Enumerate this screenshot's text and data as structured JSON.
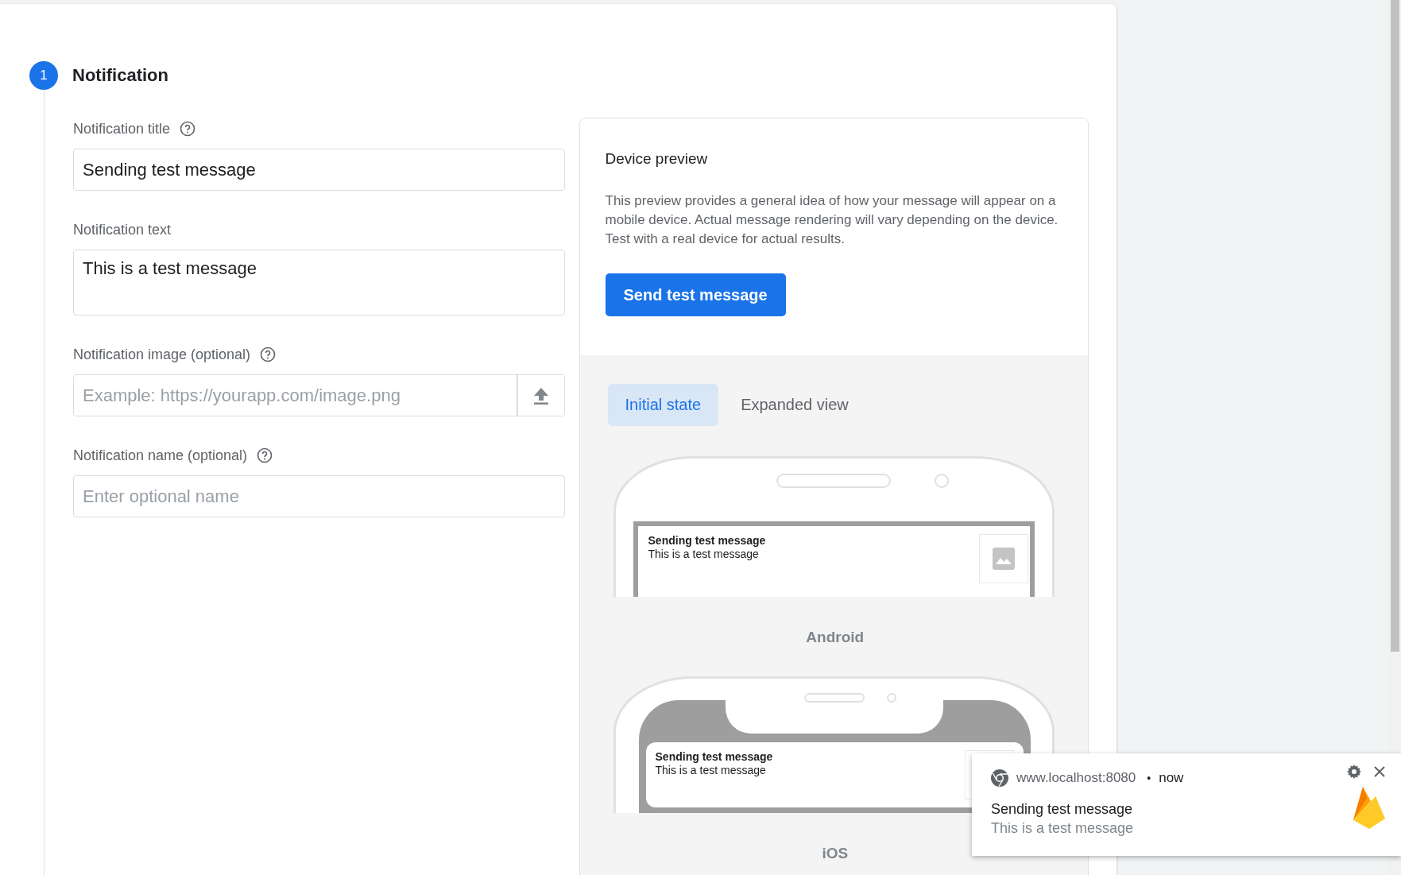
{
  "step": {
    "number": "1",
    "title": "Notification"
  },
  "fields": [
    {
      "kind": "input",
      "label": "Notification title",
      "help": true,
      "value": "Sending test message"
    },
    {
      "kind": "textarea",
      "label": "Notification text",
      "help": false,
      "value": "This is a test message"
    },
    {
      "kind": "upload",
      "label": "Notification image (optional)",
      "help": true,
      "placeholder": "Example: https://yourapp.com/image.png"
    },
    {
      "kind": "input",
      "label": "Notification name (optional)",
      "help": true,
      "placeholder": "Enter optional name"
    }
  ],
  "preview": {
    "title": "Device preview",
    "description": "This preview provides a general idea of how your message will appear on a mobile device. Actual message rendering will vary depending on the device. Test with a real device for actual results.",
    "button": "Send test message",
    "tabs": [
      {
        "label": "Initial state",
        "selected": true
      },
      {
        "label": "Expanded view",
        "selected": false
      }
    ],
    "devices": [
      {
        "kind": "android",
        "label": "Android",
        "notification_title": "Sending test message",
        "notification_text": "This is a test message"
      },
      {
        "kind": "ios",
        "label": "iOS",
        "notification_title": "Sending test message",
        "notification_text": "This is a test message"
      }
    ]
  },
  "toast": {
    "origin": "www.localhost:8080",
    "separator": "•",
    "time": "now",
    "title": "Sending test message",
    "text": "This is a test message"
  }
}
